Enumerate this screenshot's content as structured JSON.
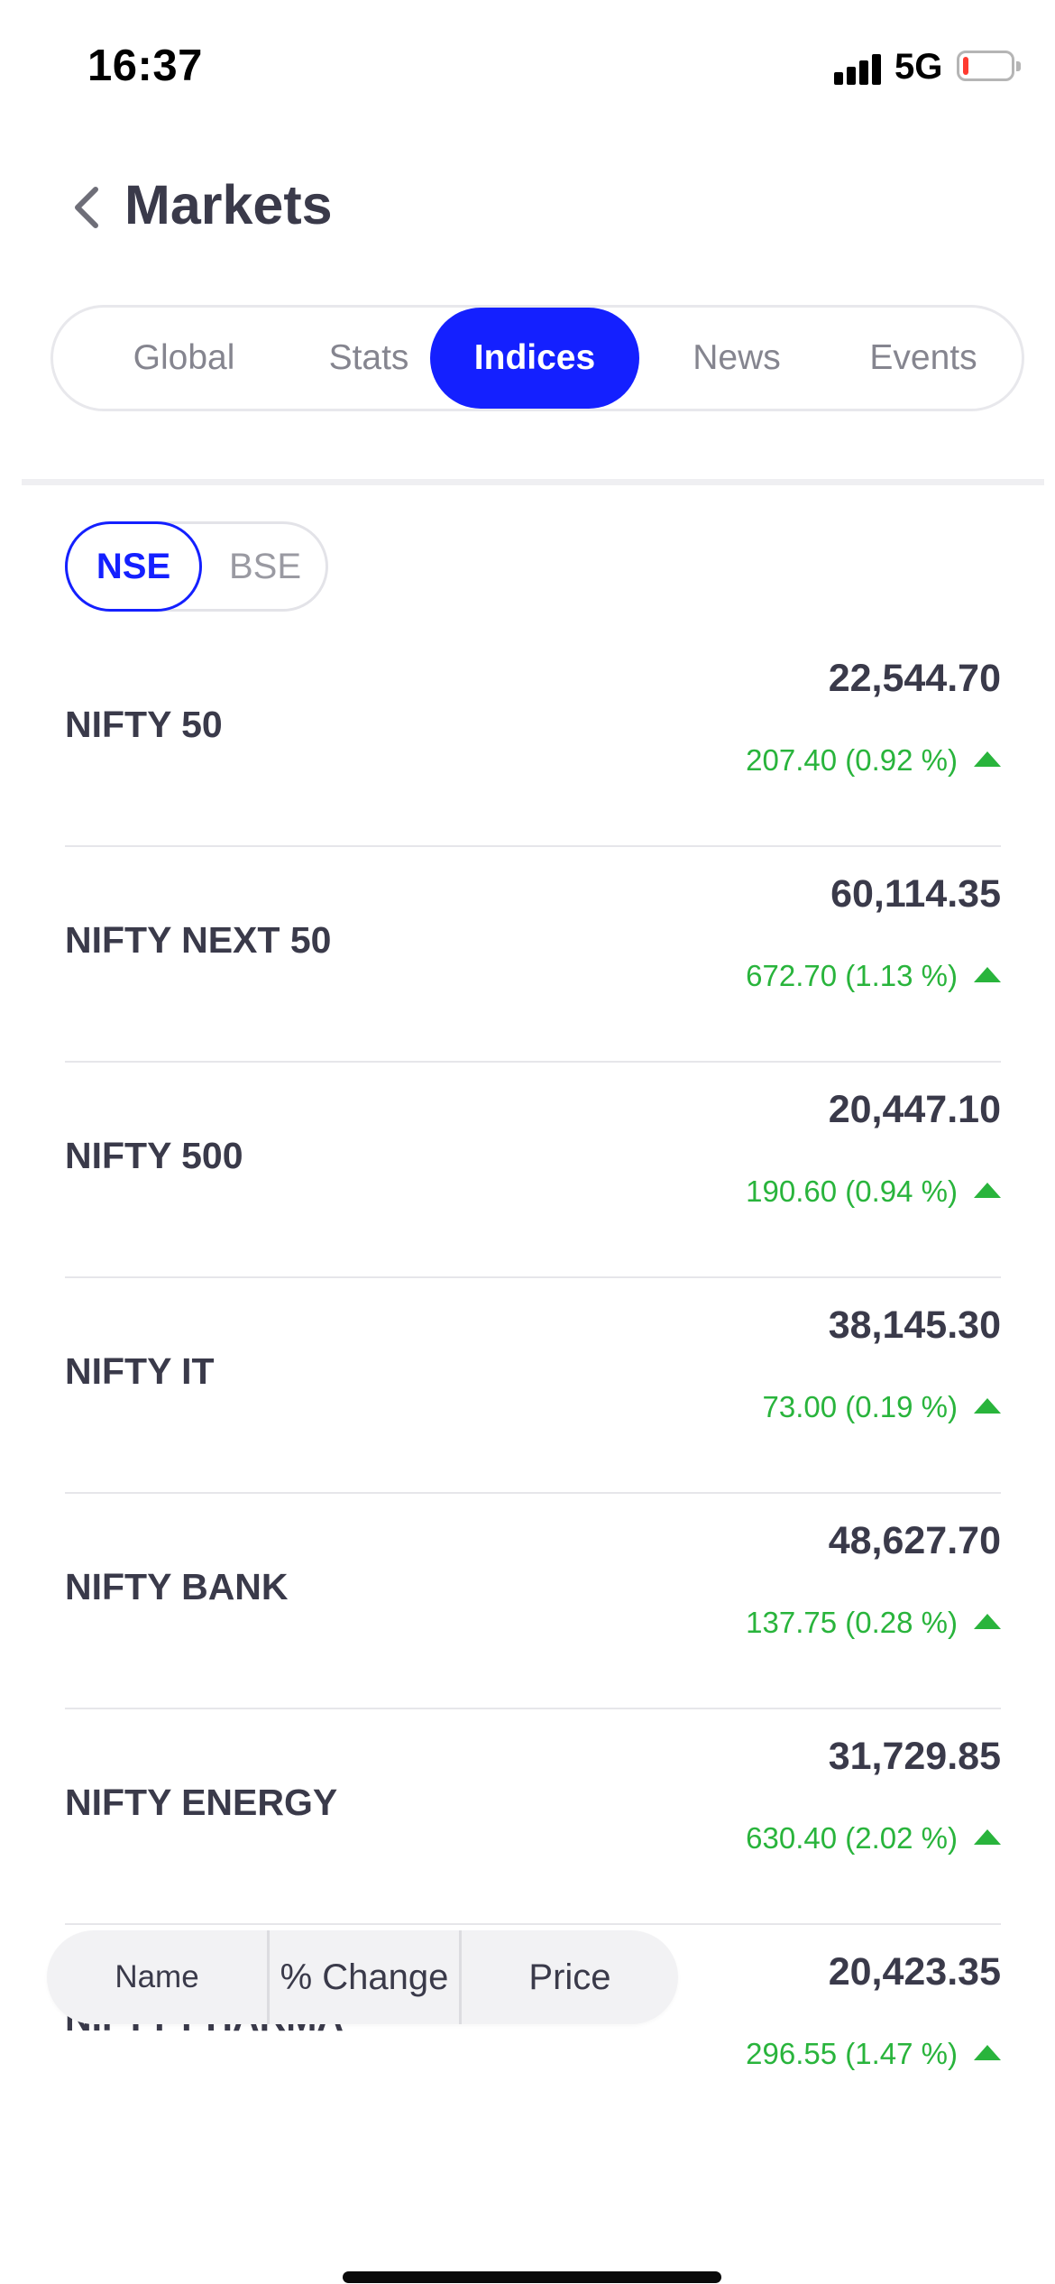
{
  "status_bar": {
    "time": "16:37",
    "network": "5G",
    "battery_level_fraction": 0.1,
    "battery_color": "#ff3b30"
  },
  "header": {
    "back_icon": "chevron-left-icon",
    "title": "Markets"
  },
  "tabs": [
    {
      "label": "Global",
      "active": false
    },
    {
      "label": "Stats",
      "active": false
    },
    {
      "label": "Indices",
      "active": true
    },
    {
      "label": "News",
      "active": false
    },
    {
      "label": "Events",
      "active": false
    }
  ],
  "exchange_toggle": {
    "options": [
      "NSE",
      "BSE"
    ],
    "selected": "NSE"
  },
  "indices": [
    {
      "name": "NIFTY 50",
      "price": "22,544.70",
      "change": "207.40 (0.92 %)",
      "direction": "up"
    },
    {
      "name": "NIFTY NEXT 50",
      "price": "60,114.35",
      "change": "672.70 (1.13 %)",
      "direction": "up"
    },
    {
      "name": "NIFTY 500",
      "price": "20,447.10",
      "change": "190.60 (0.94 %)",
      "direction": "up"
    },
    {
      "name": "NIFTY IT",
      "price": "38,145.30",
      "change": "73.00 (0.19 %)",
      "direction": "up"
    },
    {
      "name": "NIFTY BANK",
      "price": "48,627.70",
      "change": "137.75 (0.28 %)",
      "direction": "up"
    },
    {
      "name": "NIFTY ENERGY",
      "price": "31,729.85",
      "change": "630.40 (2.02 %)",
      "direction": "up"
    },
    {
      "name": "NIFTY PHARMA",
      "price": "20,423.35",
      "change": "296.55 (1.47 %)",
      "direction": "up"
    }
  ],
  "sort_bar": {
    "options": [
      "Name",
      "% Change",
      "Price"
    ]
  },
  "colors": {
    "accent": "#1420ff",
    "positive": "#29b43c",
    "text": "#3a3a4a",
    "muted": "#85858f"
  }
}
